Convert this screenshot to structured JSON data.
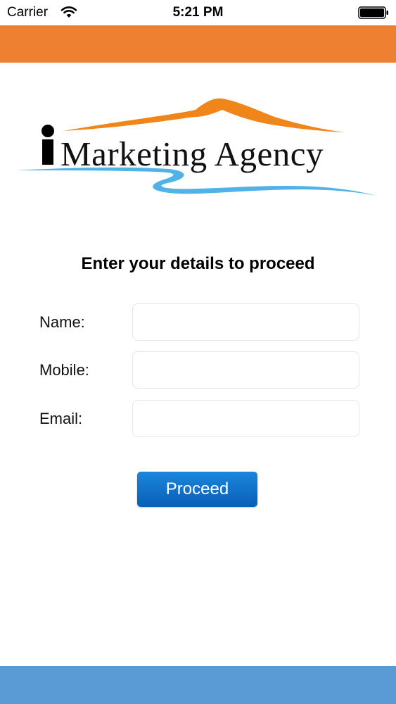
{
  "status_bar": {
    "carrier": "Carrier",
    "time": "5:21 PM"
  },
  "logo": {
    "text": "Marketing Agency",
    "colors": {
      "mountain": "#f0861a",
      "river": "#4fb3e8",
      "text": "#111111"
    }
  },
  "form": {
    "heading": "Enter your details to proceed",
    "fields": [
      {
        "label": "Name:",
        "value": "",
        "placeholder": ""
      },
      {
        "label": "Mobile:",
        "value": "",
        "placeholder": ""
      },
      {
        "label": "Email:",
        "value": "",
        "placeholder": ""
      }
    ],
    "proceed_label": "Proceed"
  },
  "colors": {
    "header": "#ee8032",
    "footer": "#5a9bd5",
    "button": "#0a6fcb"
  }
}
